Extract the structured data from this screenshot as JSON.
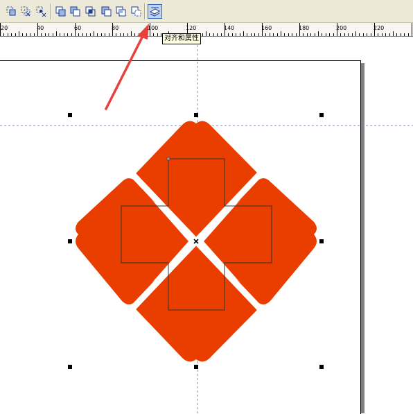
{
  "toolbar": {
    "buttons": [
      {
        "icon": "weld-icon"
      },
      {
        "icon": "trim-icon"
      },
      {
        "icon": "intersect-icon"
      },
      {
        "icon": "simplify-icon"
      },
      {
        "icon": "front-minus-back-icon"
      },
      {
        "icon": "back-minus-front-icon"
      },
      {
        "icon": "create-boundary-icon"
      },
      {
        "icon": "combine-icon"
      },
      {
        "icon": "break-apart-icon"
      },
      {
        "icon": "align-and-distribute-icon"
      }
    ],
    "tooltip": "对齐和属性"
  },
  "ruler": {
    "labels": [
      "20",
      "40",
      "60",
      "80",
      "100",
      "120",
      "140",
      "160",
      "180",
      "200",
      "220"
    ]
  },
  "colors": {
    "shape_fill": "#ea3e00",
    "guide": "#8888bb",
    "annotation_arrow": "#e8403a",
    "selection_handle": "#000000",
    "toolbar_bg": "#ece9d8"
  }
}
